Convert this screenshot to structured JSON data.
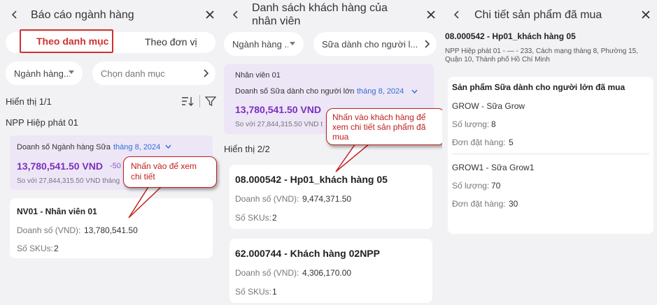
{
  "panel1": {
    "title": "Báo cáo ngành hàng",
    "tabs": [
      "Theo danh mục",
      "Theo đơn vị"
    ],
    "filter1": "Ngành hàng...",
    "filter2": "Chọn danh mục",
    "count": "Hiển thị 1/1",
    "group": "NPP Hiệp phát 01",
    "summary_label": "Doanh số Ngành hàng Sữa",
    "summary_period": "tháng 8, 2024",
    "summary_value": "13,780,541.50 VND",
    "summary_delta": "-50",
    "summary_compare": "So với 27,844,315.50 VND tháng",
    "item_title": "NV01 - Nhân viên 01",
    "item_sales_label": "Doanh số (VND):",
    "item_sales_value": "13,780,541.50",
    "item_sku_label": "Số SKUs:",
    "item_sku_value": "2",
    "callout": "Nhấn vào để xem chi tiết"
  },
  "panel2": {
    "title_line1": "Danh sách khách hàng của",
    "title_line2": "nhân viên",
    "filter1": "Ngành hàng ...",
    "filter2": "Sữa dành cho người l...",
    "emp_name": "Nhân viên 01",
    "summary_label": "Doanh số Sữa dành cho người lớn",
    "summary_period": "tháng 8, 2024",
    "summary_value": "13,780,541.50 VND",
    "summary_compare": "So với 27,844,315.50 VND t",
    "count": "Hiển thị 2/2",
    "customers": [
      {
        "title": "08.000542 - Hp01_khách hàng 05",
        "sales_label": "Doanh số (VND):",
        "sales_value": "9,474,371.50",
        "sku_label": "Số SKUs:",
        "sku_value": "2"
      },
      {
        "title": "62.000744 - Khách hàng 02NPP",
        "sales_label": "Doanh số (VND):",
        "sales_value": "4,306,170.00",
        "sku_label": "Số SKUs:",
        "sku_value": "1"
      }
    ],
    "callout": "Nhấn vào khách hàng để xem chi tiết sản phẩm đã mua"
  },
  "panel3": {
    "title": "Chi tiết sản phẩm đã mua",
    "customer": "08.000542 - Hp01_khách hàng 05",
    "address": "NPP Hiệp phát 01 - — - 233, Cách mạng tháng 8, Phường 15, Quận 10, Thành phố Hồ Chí Minh",
    "section_title": "Sản phẩm Sữa dành cho người lớn đã mua",
    "products": [
      {
        "name": "GROW - Sữa Grow",
        "qty_label": "Số lượng:",
        "qty": "8",
        "orders_label": "Đơn đặt hàng:",
        "orders": "5"
      },
      {
        "name": "GROW1 - Sữa Grow1",
        "qty_label": "Số lượng:",
        "qty": "70",
        "orders_label": "Đơn đặt hàng:",
        "orders": "30"
      }
    ]
  },
  "colors": {
    "accent": "#7a2fbf",
    "link": "#2f6fd8",
    "callout": "#c0201f",
    "panel_bg": "#f2f2f4"
  }
}
